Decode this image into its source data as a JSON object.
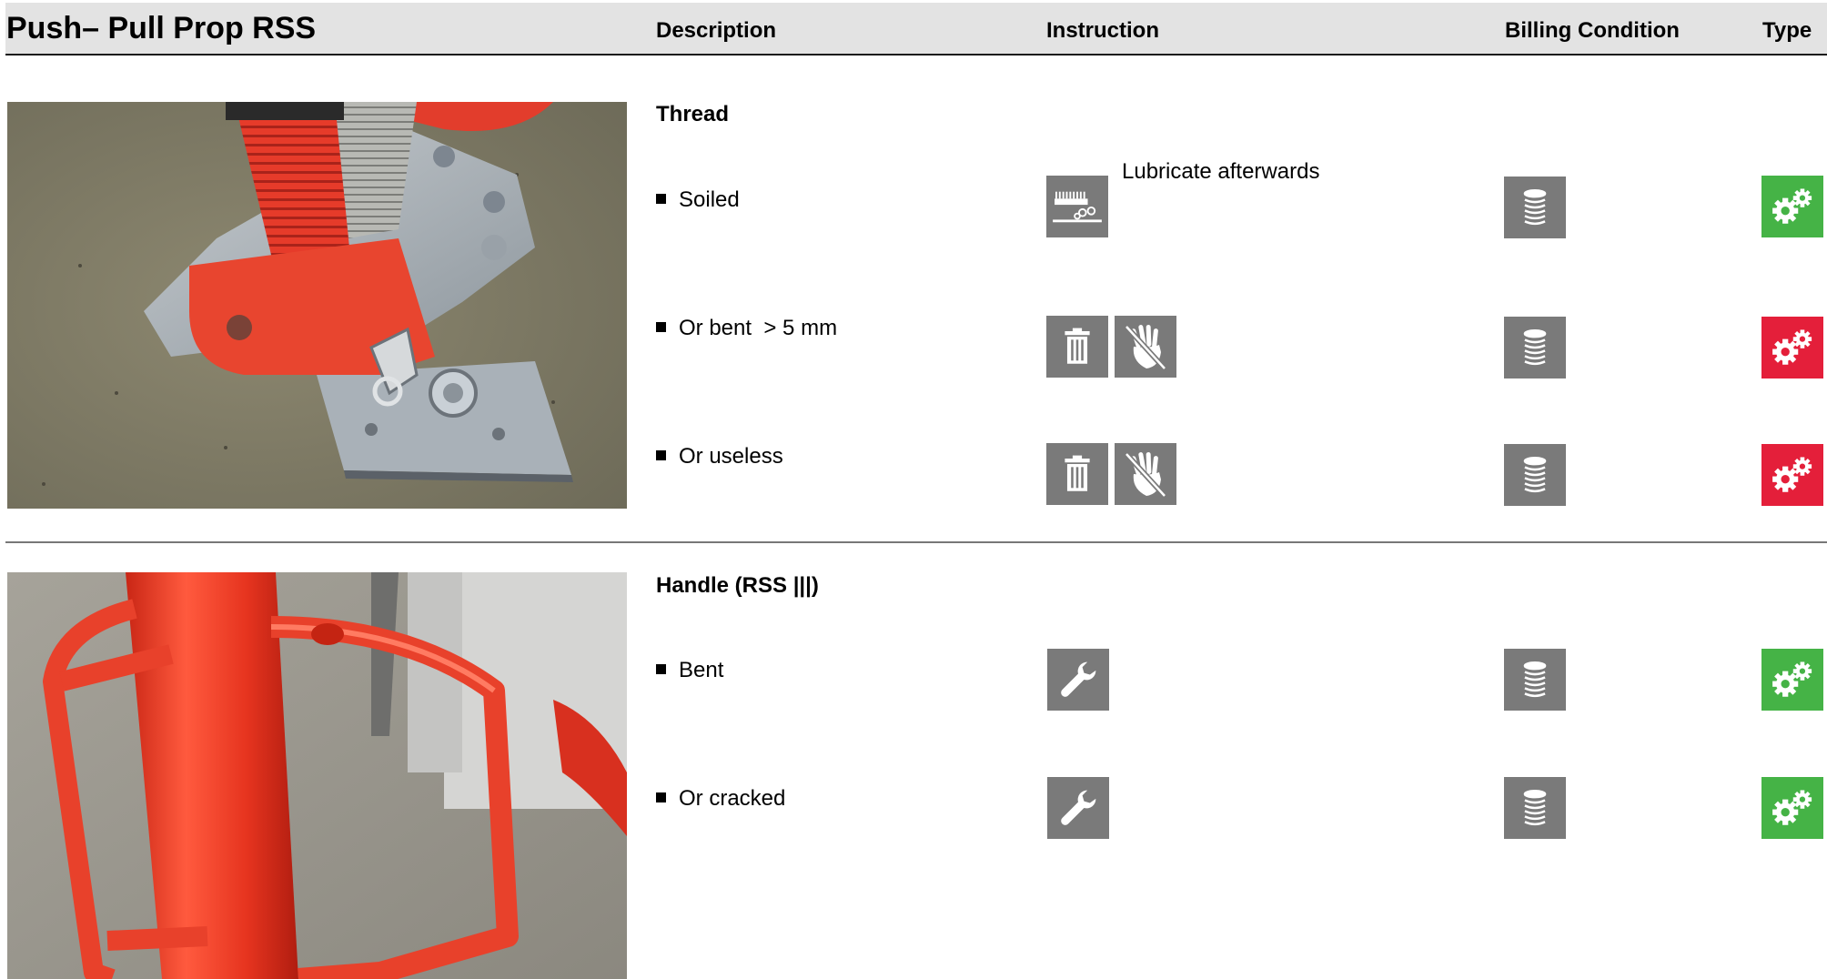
{
  "header": {
    "title": "Push– Pull Prop RSS",
    "columns": {
      "description": "Description",
      "instruction": "Instruction",
      "billing": "Billing Condition",
      "type": "Type"
    }
  },
  "sections": [
    {
      "title": "Thread",
      "items": [
        {
          "label": "Soiled",
          "note": "Lubricate afterwards",
          "instruction_icons": [
            "lubricate-icon"
          ],
          "billing_icon": "coin-stack-icon",
          "type": "green"
        },
        {
          "label": "Or bent  > 5 mm",
          "instruction_icons": [
            "trash-icon",
            "do-not-touch-icon"
          ],
          "billing_icon": "coin-stack-icon",
          "type": "red"
        },
        {
          "label": "Or useless",
          "instruction_icons": [
            "trash-icon",
            "do-not-touch-icon"
          ],
          "billing_icon": "coin-stack-icon",
          "type": "red"
        }
      ]
    },
    {
      "title": "Handle (RSS |||)",
      "items": [
        {
          "label": "Bent",
          "instruction_icons": [
            "wrench-icon"
          ],
          "billing_icon": "coin-stack-icon",
          "type": "green"
        },
        {
          "label": "Or cracked",
          "instruction_icons": [
            "wrench-icon"
          ],
          "billing_icon": "coin-stack-icon",
          "type": "green"
        }
      ]
    }
  ],
  "colors": {
    "green": "#45b346",
    "red": "#e41f3a",
    "icon_gray": "#7a7a7a",
    "header_bg": "#e3e3e3"
  }
}
